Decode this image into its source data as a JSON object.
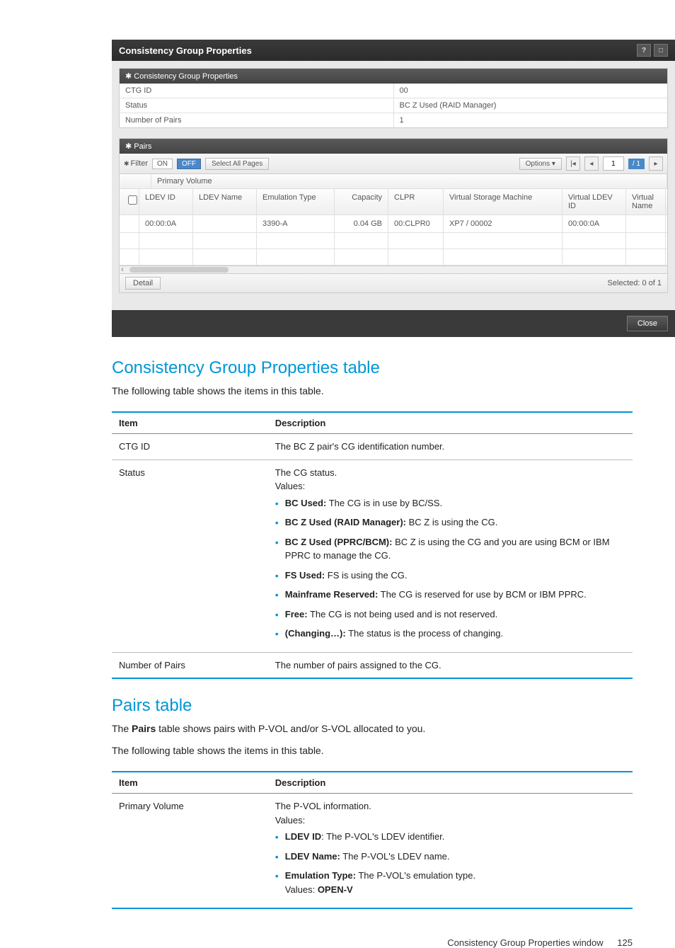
{
  "dialog": {
    "title": "Consistency Group Properties",
    "panel1_title": "✱ Consistency Group Properties",
    "rows": [
      {
        "k": "CTG ID",
        "v": "00"
      },
      {
        "k": "Status",
        "v": "BC Z Used (RAID Manager)"
      },
      {
        "k": "Number of Pairs",
        "v": "1"
      }
    ],
    "pairs_title": "✱ Pairs",
    "filter_label": "Filter",
    "on_label": "ON",
    "off_label": "OFF",
    "select_all": "Select All Pages",
    "options": "Options ▾",
    "page_current": "1",
    "page_total": "/ 1",
    "group_head": "Primary Volume",
    "columns": {
      "ldev_id": "LDEV ID",
      "ldev_name": "LDEV Name",
      "emulation": "Emulation Type",
      "capacity": "Capacity",
      "clpr": "CLPR",
      "vsm": "Virtual Storage Machine",
      "vldev": "Virtual LDEV ID",
      "vname": "Virtual Name"
    },
    "row": {
      "ldev_id": "00:00:0A",
      "ldev_name": "",
      "emulation": "3390-A",
      "capacity": "0.04 GB",
      "clpr": "00:CLPR0",
      "vsm": "XP7 / 00002",
      "vldev": "00:00:0A",
      "vname": ""
    },
    "detail": "Detail",
    "selected": "Selected:  0   of   1",
    "close": "Close"
  },
  "doc": {
    "h1": "Consistency Group Properties table",
    "p1": "The following table shows the items in this table.",
    "t1": {
      "head_item": "Item",
      "head_desc": "Description",
      "r1_item": "CTG ID",
      "r1_desc": "The BC Z pair's CG identification number.",
      "r2_item": "Status",
      "r2_intro1": "The CG status.",
      "r2_intro2": "Values:",
      "r2_b1b": "BC Used:",
      "r2_b1t": " The CG is in use by BC/SS.",
      "r2_b2b": "BC Z Used (RAID Manager):",
      "r2_b2t": " BC Z is using the CG.",
      "r2_b3b": "BC Z Used (PPRC/BCM):",
      "r2_b3t": " BC Z is using the CG and you are using BCM or IBM PPRC to manage the CG.",
      "r2_b4b": "FS Used:",
      "r2_b4t": " FS is using the CG.",
      "r2_b5b": "Mainframe Reserved:",
      "r2_b5t": " The CG is reserved for use by BCM or IBM PPRC.",
      "r2_b6b": "Free:",
      "r2_b6t": " The CG is not being used and is not reserved.",
      "r2_b7b": "(Changing…):",
      "r2_b7t": " The status is the process of changing.",
      "r3_item": "Number of Pairs",
      "r3_desc": "The number of pairs assigned to the CG."
    },
    "h2": "Pairs table",
    "p2a": "The ",
    "p2b": "Pairs",
    "p2c": " table shows pairs with P-VOL and/or S-VOL allocated to you.",
    "p3": "The following table shows the items in this table.",
    "t2": {
      "head_item": "Item",
      "head_desc": "Description",
      "r1_item": "Primary Volume",
      "r1_intro1": "The P-VOL information.",
      "r1_intro2": "Values:",
      "r1_b1b": "LDEV ID",
      "r1_b1t": ": The P-VOL's LDEV identifier.",
      "r1_b2b": "LDEV Name:",
      "r1_b2t": " The P-VOL's LDEV name.",
      "r1_b3b": "Emulation Type:",
      "r1_b3t": " The P-VOL's emulation type.",
      "r1_b4a": "Values: ",
      "r1_b4b": "OPEN-V"
    },
    "footer_text": "Consistency Group Properties window",
    "footer_page": "125"
  }
}
